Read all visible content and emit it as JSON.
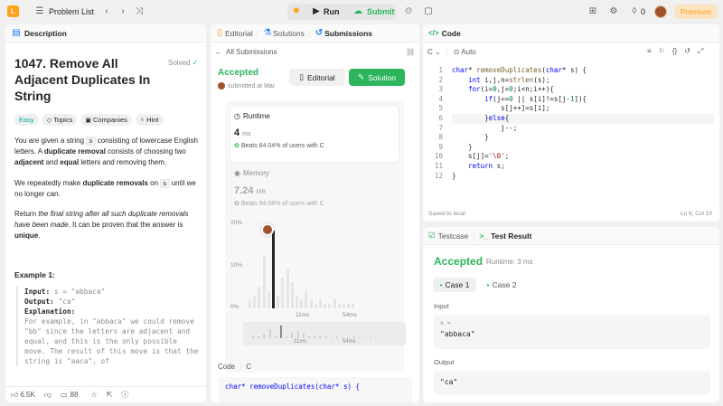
{
  "topbar": {
    "problem_list": "Problem List",
    "run": "Run",
    "submit": "Submit",
    "streak": "0",
    "premium": "Premium"
  },
  "desc": {
    "tab": "Description",
    "title": "1047. Remove All Adjacent Duplicates In String",
    "solved": "Solved",
    "tags": [
      "Easy",
      "Topics",
      "Companies",
      "Hint"
    ],
    "p1a": "You are given a string ",
    "p1code": "s",
    "p1b": " consisting of lowercase English letters. A ",
    "p1bold1": "duplicate removal",
    "p1c": " consists of choosing two ",
    "p1bold2": "adjacent",
    "p1d": " and ",
    "p1bold3": "equal",
    "p1e": " letters and removing them.",
    "p2a": "We repeatedly make ",
    "p2bold": "duplicate removals",
    "p2b": " on ",
    "p2code": "s",
    "p2c": " until we no longer can.",
    "p3a": "Return ",
    "p3i": "the final string after all such duplicate removals have been made",
    "p3b": ". It can be proven that the answer is ",
    "p3bold": "unique",
    "p3c": ".",
    "example_title": "Example 1:",
    "ex": {
      "input_label": "Input:",
      "input_val": "s = \"abbaca\"",
      "output_label": "Output:",
      "output_val": "\"ca\"",
      "expl_label": "Explanation:",
      "expl": "For example, in \"abbaca\" we could remove \"bb\" since the letters are adjacent and equal, and this is the only possible move.  The result of this move is that the string is \"aaca\", of"
    },
    "likes": "6.5K",
    "comments": "88"
  },
  "sub": {
    "tabs": [
      "Editorial",
      "Solutions",
      "Submissions"
    ],
    "all": "All Submissions",
    "status": "Accepted",
    "submitted": "submitted at Mar",
    "editorial_btn": "Editorial",
    "solution_btn": "Solution",
    "runtime_label": "Runtime",
    "runtime_val": "4",
    "runtime_unit": "ms",
    "runtime_beats": "Beats 84.04% of users with C",
    "memory_label": "Memory",
    "memory_val": "7.24",
    "memory_unit": "MB",
    "memory_beats": "Beats 94.68% of users with C",
    "y_labels": [
      "20%",
      "10%",
      "0%"
    ],
    "x_labels": [
      "11ms",
      "54ms"
    ],
    "mini_x": [
      "11ms",
      "54ms"
    ],
    "code_label": "Code",
    "code_lang": "C",
    "code_preview": "char* removeDuplicates(char* s) {"
  },
  "code": {
    "tab": "Code",
    "lang": "C",
    "auto": "Auto",
    "saved": "Saved to local",
    "pos": "Ln 6, Col 10",
    "lines": [
      "char* removeDuplicates(char* s) {",
      "    int i,j,n=strlen(s);",
      "    for(i=0,j=0;i<n;i++){",
      "        if(j==0 || s[i]!=s[j-1]){",
      "            s[j++]=s[i];",
      "        }else{",
      "            j--;",
      "        }",
      "    }",
      "    s[j]='\\0';",
      "    return s;",
      "}"
    ]
  },
  "test": {
    "tab1": "Testcase",
    "tab2": "Test Result",
    "status": "Accepted",
    "runtime": "Runtime: 3 ms",
    "case1": "Case 1",
    "case2": "Case 2",
    "input_label": "Input",
    "var": "s =",
    "input_val": "\"abbaca\"",
    "output_label": "Output",
    "output_val": "\"ca\""
  },
  "chart_data": {
    "type": "bar",
    "title": "",
    "x_labels": [
      "11ms",
      "54ms"
    ],
    "y_labels": [
      "0%",
      "10%",
      "20%"
    ],
    "ylim": [
      0,
      20
    ],
    "values": [
      2,
      3,
      5,
      12,
      4,
      18,
      3,
      7,
      9,
      6,
      3,
      2,
      4,
      2,
      1,
      2,
      1,
      1,
      2,
      1,
      1,
      1,
      1
    ],
    "highlight_index": 5,
    "highlight_color": "#262626",
    "bar_color": "#e5e5e5"
  }
}
